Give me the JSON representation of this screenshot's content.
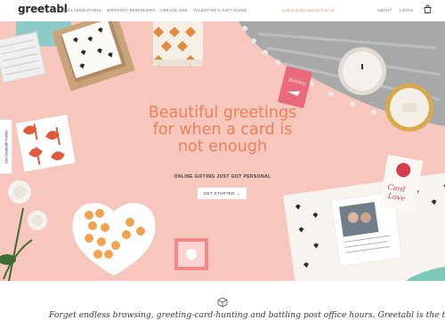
{
  "nav": {
    "logo": "greetabl",
    "links": [
      "COLLABORATIONS",
      "BIRTHDAY REMINDERS",
      "CREATE ONE",
      "VALENTINE'S GIFT GUIDE"
    ],
    "promo": "Love it, or the next one's on us",
    "about": "ABOUT",
    "login": "LOGIN",
    "cart_icon": "shopping-bag-icon"
  },
  "hero": {
    "title_line1": "Beautiful greetings",
    "title_line2": "for when a card is",
    "title_line3": "not enough",
    "subtitle": "ONLINE GIFTING JUST GOT PERSONAL",
    "cta": "GET STARTED →",
    "side_tab": "Get Greetabl Points",
    "colors": {
      "background": "#f7c7bd",
      "accent": "#ea8158"
    },
    "decor_card_text": "Card of Love",
    "decor_tag_text": "Holiday"
  },
  "below": {
    "icon": "box-icon",
    "intro": "Forget endless browsing, greeting-card-hunting and battling post office hours. Greetabl is the total"
  }
}
